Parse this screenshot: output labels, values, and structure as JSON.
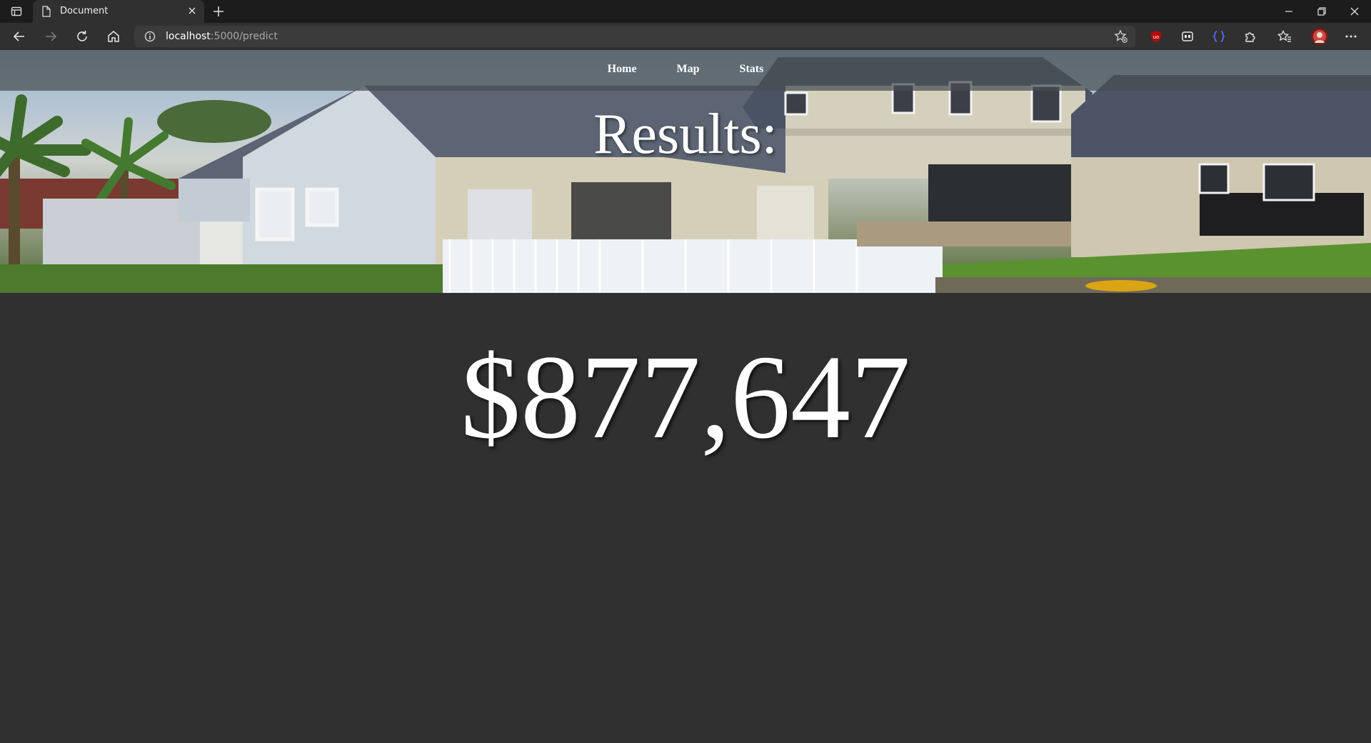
{
  "browser": {
    "tab_title": "Document",
    "url_host": "localhost",
    "url_path": ":5000/predict",
    "icons": {
      "tab_actions": "tab-actions-icon",
      "page": "document-icon",
      "close_tab": "close-icon",
      "new_tab": "plus-icon",
      "back": "back-arrow-icon",
      "forward": "forward-arrow-icon",
      "refresh": "refresh-icon",
      "home": "home-icon",
      "site_info": "info-icon",
      "add_favorite": "star-add-icon",
      "ublock": "ublock-icon",
      "extension_box": "extension-box-icon",
      "extension_brackets": "brackets-icon",
      "extensions": "puzzle-icon",
      "favorites": "favorites-icon",
      "profile": "avatar",
      "more": "more-icon",
      "minimize": "minimize-icon",
      "restore": "restore-icon",
      "close_window": "close-window-icon"
    }
  },
  "nav": {
    "home": "Home",
    "map": "Map",
    "stats": "Stats"
  },
  "hero": {
    "title": "Results:"
  },
  "result": {
    "price": "$877,647"
  },
  "colors": {
    "page_background": "#303030",
    "browser_titlebar": "#1c1c1c",
    "text": "#ffffff"
  }
}
